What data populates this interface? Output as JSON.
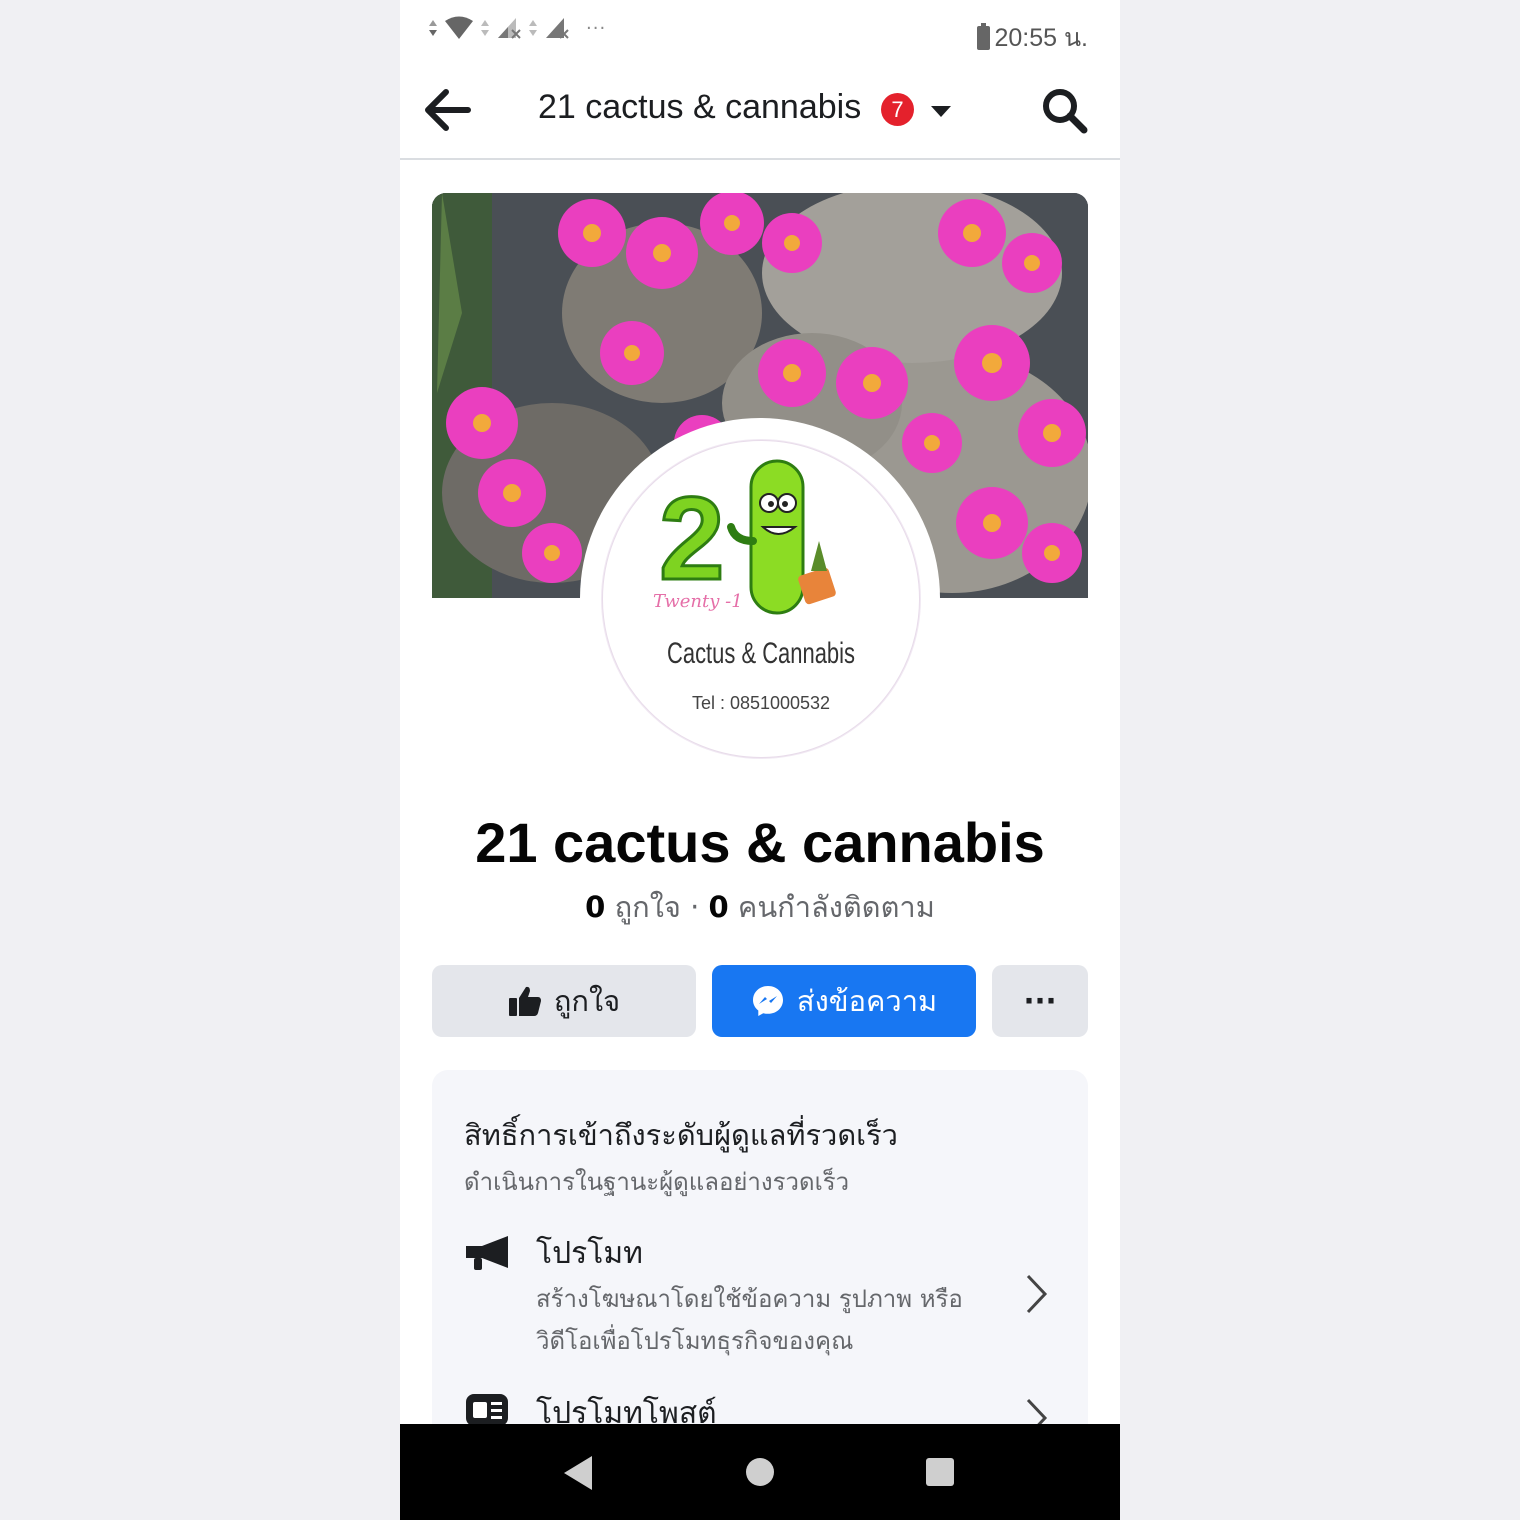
{
  "status_bar": {
    "time": "20:55 น.",
    "overflow": "···",
    "icons": [
      "data-arrows-icon",
      "wifi-icon",
      "signal-x-icon",
      "signal-x-icon",
      "battery-icon"
    ]
  },
  "header": {
    "title": "21 cactus & cannabis",
    "notification_count": "7"
  },
  "profile": {
    "logo_number": "2",
    "logo_script": "Twenty -1",
    "logo_name": "Cactus & Cannabis",
    "logo_tel": "Tel : 0851000532"
  },
  "page": {
    "name": "21 cactus & cannabis",
    "likes_count": "0",
    "likes_label": " ถูกใจ · ",
    "followers_count": "0",
    "followers_label": " คนกำลังติดตาม"
  },
  "actions": {
    "like_label": "ถูกใจ",
    "message_label": "ส่งข้อความ",
    "more_label": "···"
  },
  "admin_card": {
    "title": "สิทธิ์การเข้าถึงระดับผู้ดูแลที่รวดเร็ว",
    "subtitle": "ดำเนินการในฐานะผู้ดูแลอย่างรวดเร็ว",
    "items": [
      {
        "title": "โปรโมท",
        "desc": "สร้างโฆษณาโดยใช้ข้อความ รูปภาพ หรือวิดีโอเพื่อโปรโมทธุรกิจของคุณ"
      },
      {
        "title": "โปรโมทโพสต์",
        "desc": ""
      }
    ]
  },
  "colors": {
    "accent": "#1877f2",
    "badge": "#e4212c",
    "button_gray": "#e4e6eb",
    "card_bg": "#f5f6fa"
  }
}
